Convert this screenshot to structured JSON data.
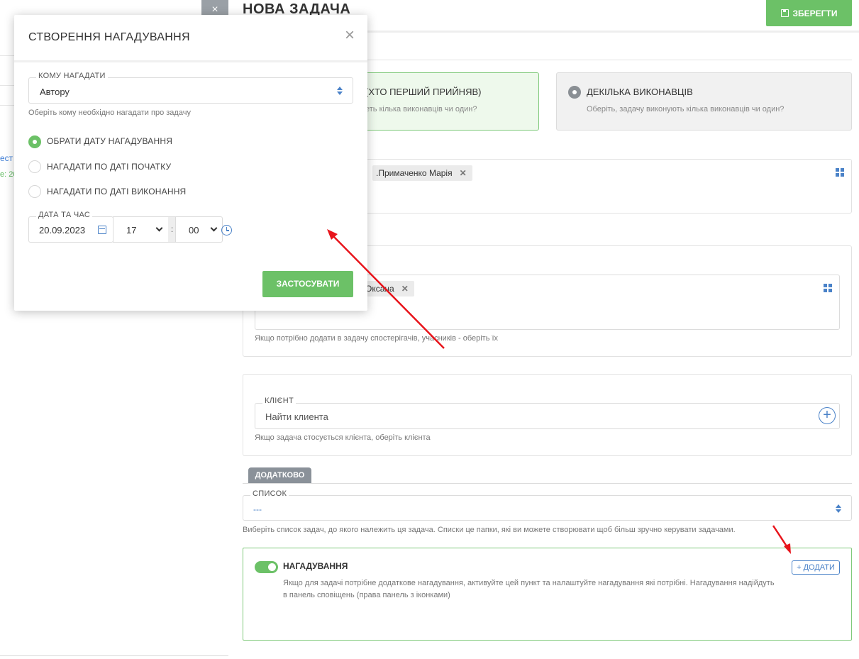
{
  "background": {
    "left_fragments": [
      "ест",
      "e: 20"
    ]
  },
  "header": {
    "title": "НОВА ЗАДАЧА",
    "save_label": "ЗБЕРЕГТИ",
    "close_glyph": "×"
  },
  "assignment": {
    "option1_title": "(ХТО ПЕРШИЙ ПРИЙНЯВ)",
    "option1_sub": "еть кілька виконавців чи один?",
    "option2_title": "ДЕКІЛЬКА ВИКОНАВЦІВ",
    "option2_sub": "Оберіть, задачу виконують кілька виконавців чи один?"
  },
  "executors": {
    "tags": [
      ".Примаченко Марія"
    ]
  },
  "observers": {
    "tags": [
      "о Оксана"
    ],
    "hint": "Якщо потрібно додати в задачу спостерігачів, учасників - оберіть їх"
  },
  "client": {
    "legend": "КЛІЄНТ",
    "placeholder": "Найти клиента",
    "hint": "Якщо задача стосується клієнта, оберіть клієнта"
  },
  "extra": {
    "tab_label": "ДОДАТКОВО",
    "list_legend": "СПИСОК",
    "list_value": "---",
    "list_hint": "Виберіть список задач, до якого належить ця задача. Списки це папки, які ви можете створювати щоб більш зручно керувати задачами."
  },
  "reminder": {
    "title": "НАГАДУВАННЯ",
    "add_label": "+ ДОДАТИ",
    "description_line1": "Якщо для задачі потрібне додаткове нагадування, активуйте цей пункт та налаштуйте нагадування які потрібні. Нагадування надійдуть",
    "description_line2": "в панель сповіщень (права панель з іконками)",
    "enabled": true
  },
  "modal": {
    "title": "СТВОРЕННЯ НАГАДУВАННЯ",
    "whom_legend": "КОМУ НАГАДАТИ",
    "whom_value": "Автору",
    "whom_hint": "Оберіть кому необхідно нагадати про задачу",
    "radios": [
      {
        "label": "ОБРАТИ ДАТУ НАГАДУВАННЯ",
        "selected": true
      },
      {
        "label": "НАГАДАТИ ПО ДАТІ ПОЧАТКУ",
        "selected": false
      },
      {
        "label": "НАГАДАТИ ПО ДАТІ ВИКОНАННЯ",
        "selected": false
      }
    ],
    "datetime_legend": "ДАТА ТА ЧАС",
    "date_value": "20.09.2023",
    "hour_value": "17",
    "time_separator": ":",
    "minute_value": "00",
    "apply_label": "ЗАСТОСУВАТИ"
  },
  "colors": {
    "accent_green": "#6cc167",
    "accent_blue": "#4a82c8",
    "annotation_red": "#e8141b"
  }
}
